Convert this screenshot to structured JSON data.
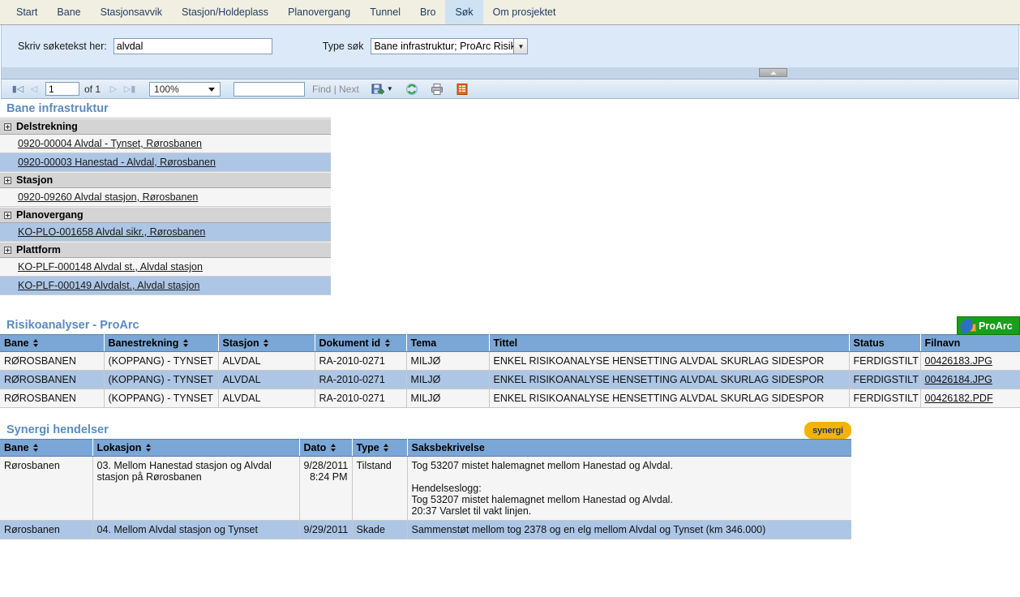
{
  "nav": {
    "tabs": [
      {
        "label": "Start",
        "active": false
      },
      {
        "label": "Bane",
        "active": false
      },
      {
        "label": "Stasjonsavvik",
        "active": false
      },
      {
        "label": "Stasjon/Holdeplass",
        "active": false
      },
      {
        "label": "Planovergang",
        "active": false
      },
      {
        "label": "Tunnel",
        "active": false
      },
      {
        "label": "Bro",
        "active": false
      },
      {
        "label": "Søk",
        "active": true
      },
      {
        "label": "Om prosjektet",
        "active": false
      }
    ]
  },
  "search": {
    "label": "Skriv søketekst her:",
    "value": "alvdal",
    "placeholder": "",
    "type_label": "Type søk",
    "type_value": "Bane infrastruktur; ProArc Risiko"
  },
  "toolbar": {
    "page_value": "1",
    "of_label": "of 1",
    "zoom_value": "100%",
    "find_value": "",
    "find_label": "Find | Next",
    "icons": [
      "export-icon",
      "refresh-icon",
      "print-icon",
      "report-icon"
    ]
  },
  "tree": {
    "title": "Bane infrastruktur",
    "groups": [
      {
        "label": "Delstrekning",
        "items": [
          {
            "label": "0920-00004 Alvdal - Tynset, Rørosbanen",
            "selected": false
          },
          {
            "label": "0920-00003 Hanestad - Alvdal, Rørosbanen",
            "selected": true
          }
        ]
      },
      {
        "label": "Stasjon",
        "items": [
          {
            "label": "0920-09260 Alvdal stasjon, Rørosbanen",
            "selected": false
          }
        ]
      },
      {
        "label": "Planovergang",
        "items": [
          {
            "label": "KO-PLO-001658 Alvdal sikr., Rørosbanen",
            "selected": true
          }
        ]
      },
      {
        "label": "Plattform",
        "items": [
          {
            "label": "KO-PLF-000148 Alvdal st., Alvdal stasjon",
            "selected": false
          },
          {
            "label": "KO-PLF-000149 Alvdalst., Alvdal stasjon",
            "selected": true
          }
        ]
      }
    ]
  },
  "risiko": {
    "title": "Risikoanalyser - ProArc",
    "logo_text": "ProArc",
    "columns": [
      {
        "label": "Bane",
        "sortable": true
      },
      {
        "label": "Banestrekning",
        "sortable": true
      },
      {
        "label": "Stasjon",
        "sortable": true
      },
      {
        "label": "Dokument id",
        "sortable": true
      },
      {
        "label": "Tema",
        "sortable": false
      },
      {
        "label": "Tittel",
        "sortable": false
      },
      {
        "label": "Status",
        "sortable": false
      },
      {
        "label": "Filnavn",
        "sortable": false
      }
    ],
    "rows": [
      {
        "alt": false,
        "bane": "RØROSBANEN",
        "banestrekning": "(KOPPANG) - TYNSET",
        "stasjon": "ALVDAL",
        "dokument_id": "RA-2010-0271",
        "tema": "MILJØ",
        "tittel": "ENKEL RISIKOANALYSE HENSETTING ALVDAL SKURLAG SIDESPOR",
        "status": "FERDIGSTILT",
        "filnavn": "00426183.JPG"
      },
      {
        "alt": true,
        "bane": "RØROSBANEN",
        "banestrekning": "(KOPPANG) - TYNSET",
        "stasjon": "ALVDAL",
        "dokument_id": "RA-2010-0271",
        "tema": "MILJØ",
        "tittel": "ENKEL RISIKOANALYSE HENSETTING ALVDAL SKURLAG SIDESPOR",
        "status": "FERDIGSTILT",
        "filnavn": "00426184.JPG"
      },
      {
        "alt": false,
        "bane": "RØROSBANEN",
        "banestrekning": "(KOPPANG) - TYNSET",
        "stasjon": "ALVDAL",
        "dokument_id": "RA-2010-0271",
        "tema": "MILJØ",
        "tittel": "ENKEL RISIKOANALYSE HENSETTING ALVDAL SKURLAG SIDESPOR",
        "status": "FERDIGSTILT",
        "filnavn": "00426182.PDF"
      }
    ]
  },
  "synergi": {
    "title": "Synergi hendelser",
    "logo_text": "synergi",
    "columns": [
      {
        "label": "Bane",
        "sortable": true
      },
      {
        "label": "Lokasjon",
        "sortable": true
      },
      {
        "label": "Dato",
        "sortable": true
      },
      {
        "label": "Type",
        "sortable": true
      },
      {
        "label": "Saksbekrivelse",
        "sortable": false
      }
    ],
    "rows": [
      {
        "alt": false,
        "bane": "Rørosbanen",
        "lokasjon": "03. Mellom Hanestad stasjon og Alvdal stasjon på Rørosbanen",
        "dato": "9/28/2011 8:24 PM",
        "type": "Tilstand",
        "saksbekrivelse": "Tog 53207 mistet halemagnet mellom Hanestad og Alvdal.\n\nHendelseslogg:\nTog 53207 mistet halemagnet mellom Hanestad og Alvdal.\n20:37 Varslet til vakt linjen."
      },
      {
        "alt": true,
        "bane": "Rørosbanen",
        "lokasjon": "04. Mellom Alvdal stasjon og Tynset",
        "dato": "9/29/2011",
        "type": "Skade",
        "saksbekrivelse": "Sammenstøt mellom tog 2378 og en elg mellom Alvdal og Tynset (km 346.000)"
      }
    ]
  }
}
